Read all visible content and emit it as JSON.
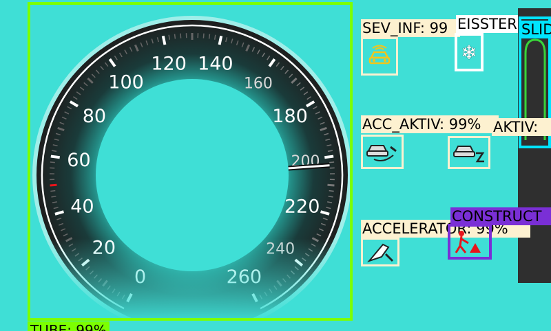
{
  "gauge": {
    "ticks": [
      "0",
      "20",
      "40",
      "60",
      "80",
      "100",
      "120",
      "140",
      "160",
      "180",
      "200",
      "220",
      "240",
      "260"
    ],
    "needle_value": 203,
    "max_value": 260,
    "label": "TUBE: 99%"
  },
  "detections": {
    "sev_inf": {
      "label": "SEV_INF: 99",
      "icon": "car-warning-icon",
      "color": "#f5c518"
    },
    "eisstern": {
      "label": "EISSTERN",
      "icon": "snowflake-icon"
    },
    "slider": {
      "label": "SLID"
    },
    "acc_aktiv": {
      "label": "ACC_AKTIV: 99%",
      "icon": "acc-car-icon"
    },
    "acc_aktiv_2": {
      "label": "AKTIV: ",
      "icon": "acc-car-hourglass-icon"
    },
    "accelerator": {
      "label": "ACCELERATOR: 99%",
      "icon": "accelerator-pedal-icon"
    },
    "construction": {
      "label": "CONSTRUCT",
      "icon": "construction-icon"
    }
  },
  "colors": {
    "background": "#3fdfd6",
    "tube_box": "#7cff00",
    "construction_box": "#7a2fd6",
    "slider_box": "#00e5ff",
    "label_bg": "#fdf1d0"
  }
}
